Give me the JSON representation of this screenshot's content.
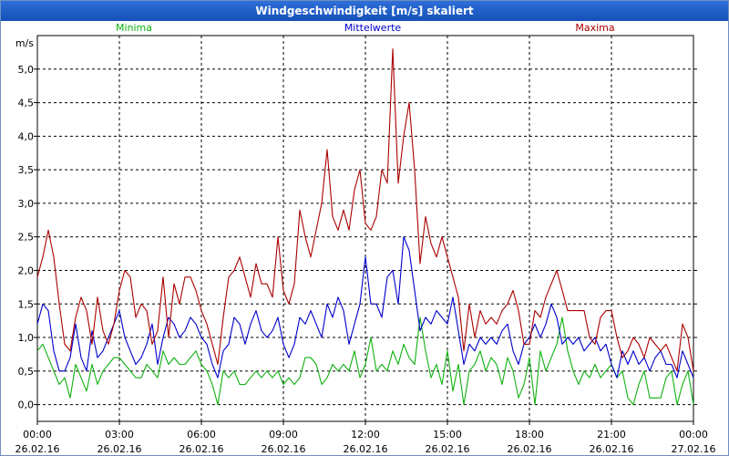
{
  "window": {
    "title": "Windgeschwindigkeit [m/s] skaliert"
  },
  "chart_data": {
    "type": "line",
    "title": "Windgeschwindigkeit [m/s] skaliert",
    "ylabel": "m/s",
    "ylim": [
      -0.25,
      5.5
    ],
    "y_ticks": [
      "0,0",
      "0,5",
      "1,0",
      "1,5",
      "2,0",
      "2,5",
      "3,0",
      "3,5",
      "4,0",
      "4,5",
      "5,0"
    ],
    "x_range_hours": [
      0,
      24
    ],
    "x_ticks": [
      {
        "time": "00:00",
        "date": "26.02.16"
      },
      {
        "time": "03:00",
        "date": "26.02.16"
      },
      {
        "time": "06:00",
        "date": "26.02.16"
      },
      {
        "time": "09:00",
        "date": "26.02.16"
      },
      {
        "time": "12:00",
        "date": "26.02.16"
      },
      {
        "time": "15:00",
        "date": "26.02.16"
      },
      {
        "time": "18:00",
        "date": "26.02.16"
      },
      {
        "time": "21:00",
        "date": "26.02.16"
      },
      {
        "time": "00:00",
        "date": "27.02.16"
      }
    ],
    "grid": true,
    "legend_position": "top",
    "x": [
      0.0,
      0.2,
      0.4,
      0.6,
      0.8,
      1.0,
      1.2,
      1.4,
      1.6,
      1.8,
      2.0,
      2.2,
      2.4,
      2.6,
      2.8,
      3.0,
      3.2,
      3.4,
      3.6,
      3.8,
      4.0,
      4.2,
      4.4,
      4.6,
      4.8,
      5.0,
      5.2,
      5.4,
      5.6,
      5.8,
      6.0,
      6.2,
      6.4,
      6.6,
      6.8,
      7.0,
      7.2,
      7.4,
      7.6,
      7.8,
      8.0,
      8.2,
      8.4,
      8.6,
      8.8,
      9.0,
      9.2,
      9.4,
      9.6,
      9.8,
      10.0,
      10.2,
      10.4,
      10.6,
      10.8,
      11.0,
      11.2,
      11.4,
      11.6,
      11.8,
      12.0,
      12.2,
      12.4,
      12.6,
      12.8,
      13.0,
      13.2,
      13.4,
      13.6,
      13.8,
      14.0,
      14.2,
      14.4,
      14.6,
      14.8,
      15.0,
      15.2,
      15.4,
      15.6,
      15.8,
      16.0,
      16.2,
      16.4,
      16.6,
      16.8,
      17.0,
      17.2,
      17.4,
      17.6,
      17.8,
      18.0,
      18.2,
      18.4,
      18.6,
      18.8,
      19.0,
      19.2,
      19.4,
      19.6,
      19.8,
      20.0,
      20.2,
      20.4,
      20.6,
      20.8,
      21.0,
      21.2,
      21.4,
      21.6,
      21.8,
      22.0,
      22.2,
      22.4,
      22.6,
      22.8,
      23.0,
      23.2,
      23.4,
      23.6,
      23.8,
      24.0
    ],
    "series": [
      {
        "name": "Minima",
        "color": "#10b010",
        "values": [
          0.8,
          0.9,
          0.7,
          0.5,
          0.3,
          0.4,
          0.1,
          0.6,
          0.4,
          0.2,
          0.6,
          0.3,
          0.5,
          0.6,
          0.7,
          0.7,
          0.6,
          0.5,
          0.4,
          0.4,
          0.6,
          0.5,
          0.4,
          0.8,
          0.6,
          0.7,
          0.6,
          0.6,
          0.7,
          0.8,
          0.6,
          0.5,
          0.3,
          0.0,
          0.5,
          0.4,
          0.5,
          0.3,
          0.3,
          0.4,
          0.5,
          0.4,
          0.5,
          0.4,
          0.5,
          0.3,
          0.4,
          0.3,
          0.4,
          0.7,
          0.7,
          0.6,
          0.3,
          0.4,
          0.6,
          0.5,
          0.6,
          0.5,
          0.8,
          0.4,
          0.6,
          1.0,
          0.5,
          0.6,
          0.5,
          0.8,
          0.6,
          0.9,
          0.7,
          0.6,
          1.3,
          0.8,
          0.4,
          0.6,
          0.3,
          0.8,
          0.2,
          0.6,
          0.0,
          0.5,
          0.6,
          0.8,
          0.5,
          0.7,
          0.6,
          0.3,
          0.7,
          0.5,
          0.1,
          0.3,
          0.7,
          0.0,
          0.8,
          0.5,
          0.7,
          0.9,
          1.3,
          0.8,
          0.5,
          0.3,
          0.5,
          0.4,
          0.6,
          0.4,
          0.5,
          0.6,
          0.4,
          0.5,
          0.1,
          0.0,
          0.3,
          0.5,
          0.1,
          0.1,
          0.1,
          0.4,
          0.5,
          0.0,
          0.3,
          0.5,
          0.0
        ]
      },
      {
        "name": "Mittelwerte",
        "color": "#0000cc",
        "values": [
          1.2,
          1.5,
          1.4,
          0.8,
          0.5,
          0.5,
          0.7,
          1.2,
          0.7,
          0.5,
          1.1,
          0.7,
          0.8,
          1.0,
          1.2,
          1.4,
          1.0,
          0.8,
          0.6,
          0.7,
          0.9,
          1.2,
          0.6,
          1.0,
          1.3,
          1.2,
          1.0,
          1.1,
          1.3,
          1.2,
          1.0,
          0.9,
          0.6,
          0.4,
          0.8,
          0.9,
          1.3,
          1.2,
          0.9,
          1.2,
          1.4,
          1.1,
          1.0,
          1.1,
          1.3,
          0.9,
          0.7,
          0.9,
          1.3,
          1.2,
          1.4,
          1.2,
          1.0,
          1.5,
          1.3,
          1.6,
          1.4,
          0.9,
          1.2,
          1.5,
          2.2,
          1.5,
          1.5,
          1.3,
          1.9,
          2.0,
          1.5,
          2.5,
          2.3,
          1.7,
          1.1,
          1.3,
          1.2,
          1.4,
          1.3,
          1.2,
          1.6,
          1.1,
          0.6,
          0.9,
          0.8,
          1.0,
          0.9,
          1.0,
          0.9,
          1.1,
          1.2,
          0.8,
          0.6,
          0.9,
          1.0,
          1.2,
          1.0,
          1.2,
          1.5,
          1.3,
          0.9,
          1.0,
          0.9,
          1.0,
          0.8,
          0.9,
          1.0,
          0.8,
          0.9,
          0.6,
          0.4,
          0.8,
          0.6,
          0.8,
          0.6,
          0.7,
          0.5,
          0.7,
          0.8,
          0.6,
          0.6,
          0.4,
          0.8,
          0.6,
          0.4
        ]
      },
      {
        "name": "Maxima",
        "color": "#aa0000",
        "values": [
          1.9,
          2.2,
          2.6,
          2.2,
          1.5,
          0.9,
          0.8,
          1.3,
          1.6,
          1.4,
          0.9,
          1.6,
          1.1,
          0.9,
          1.2,
          1.7,
          2.0,
          1.9,
          1.3,
          1.5,
          1.4,
          0.9,
          1.1,
          1.9,
          1.0,
          1.8,
          1.5,
          1.9,
          1.9,
          1.7,
          1.4,
          1.2,
          0.9,
          0.6,
          1.3,
          1.9,
          2.0,
          2.2,
          1.9,
          1.6,
          2.1,
          1.8,
          1.8,
          1.6,
          2.5,
          1.7,
          1.5,
          1.8,
          2.9,
          2.5,
          2.2,
          2.6,
          3.0,
          3.8,
          2.8,
          2.6,
          2.9,
          2.6,
          3.2,
          3.5,
          2.7,
          2.6,
          2.8,
          3.5,
          3.3,
          5.3,
          3.3,
          4.0,
          4.5,
          3.5,
          2.1,
          2.8,
          2.4,
          2.2,
          2.5,
          2.2,
          1.9,
          1.6,
          0.8,
          1.5,
          1.0,
          1.4,
          1.2,
          1.3,
          1.2,
          1.4,
          1.5,
          1.7,
          1.4,
          0.9,
          0.9,
          1.4,
          1.3,
          1.6,
          1.8,
          2.0,
          1.7,
          1.4,
          1.4,
          1.4,
          1.4,
          1.0,
          0.9,
          1.3,
          1.4,
          1.4,
          1.0,
          0.7,
          0.8,
          1.0,
          0.9,
          0.7,
          1.0,
          0.9,
          0.8,
          0.9,
          0.7,
          0.5,
          1.2,
          1.0,
          0.5
        ]
      }
    ]
  }
}
